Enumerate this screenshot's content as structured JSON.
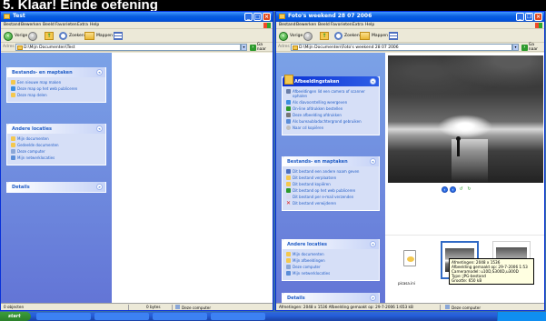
{
  "caption": "5. Klaar! Einde oefening",
  "winL": {
    "title": "Test",
    "menu": [
      "Bestand",
      "Bewerken",
      "Beeld",
      "Favorieten",
      "Extra",
      "Help"
    ],
    "toolbar": {
      "back": "Vorige",
      "search": "Zoeken",
      "folders": "Mappen"
    },
    "address_label": "Adres",
    "address": "D:\\Mijn Documenten\\Test",
    "go": "Ga naar",
    "panel1": {
      "title": "Bestands- en maptaken",
      "items": [
        "Een nieuwe map maken",
        "Deze map op het web publiceren",
        "Deze map delen"
      ]
    },
    "panel2": {
      "title": "Andere locaties",
      "items": [
        "Mijn documenten",
        "Gedeelde documenten",
        "Deze computer",
        "Mijn netwerklocaties"
      ]
    },
    "panel3": {
      "title": "Details"
    },
    "status": {
      "objects": "0 objecten",
      "size": "0 bytes",
      "location": "Deze computer"
    }
  },
  "winR": {
    "title": "Foto's weekend 28 07 2006",
    "menu": [
      "Bestand",
      "Bewerken",
      "Beeld",
      "Favorieten",
      "Extra",
      "Help"
    ],
    "toolbar": {
      "back": "Vorige",
      "search": "Zoeken",
      "folders": "Mappen"
    },
    "address_label": "Adres",
    "address": "D:\\Mijn Documenten\\Foto's weekend 28 07 2006",
    "go": "Ga naar",
    "panel1": {
      "title": "Afbeeldingstaken",
      "items": [
        "Afbeeldingen lid een camera of scanner ophalen",
        "Als diavoorstelling weergeven",
        "On-line afdrukken bestellen",
        "Deze afbeelding afdrukken",
        "Als bureaubladachtergrond gebruiken",
        "Naar cd kopiëren"
      ]
    },
    "panel2": {
      "title": "Bestands- en maptaken",
      "items": [
        "Dit bestand een andere naam geven",
        "Dit bestand verplaatsen",
        "Dit bestand kopiëren",
        "Dit bestand op het web publiceren",
        "Dit bestand per e-mail verzenden",
        "Dit bestand verwijderen"
      ]
    },
    "panel3": {
      "title": "Andere locaties",
      "items": [
        "Mijn documenten",
        "Mijn afbeeldingen",
        "Deze computer",
        "Mijn netwerklocaties"
      ]
    },
    "panel4": {
      "title": "Details"
    },
    "thumb_label": "picasa.ini",
    "tooltip": [
      "Afmetingen: 2048 x 1536",
      "Afbeelding gemaakt op: 29-7-2006 1:53",
      "Cameramodel: u10D,S300D,u300D",
      "Type: JPG-bestand",
      "Grootte: 650 kB"
    ],
    "status": {
      "info": "Afmetingen: 2048 x 1536 Afbeelding gemaakt op: 29-7-2006 1:653 kB",
      "location": "Deze computer"
    }
  },
  "taskbar": {
    "start": "start"
  }
}
